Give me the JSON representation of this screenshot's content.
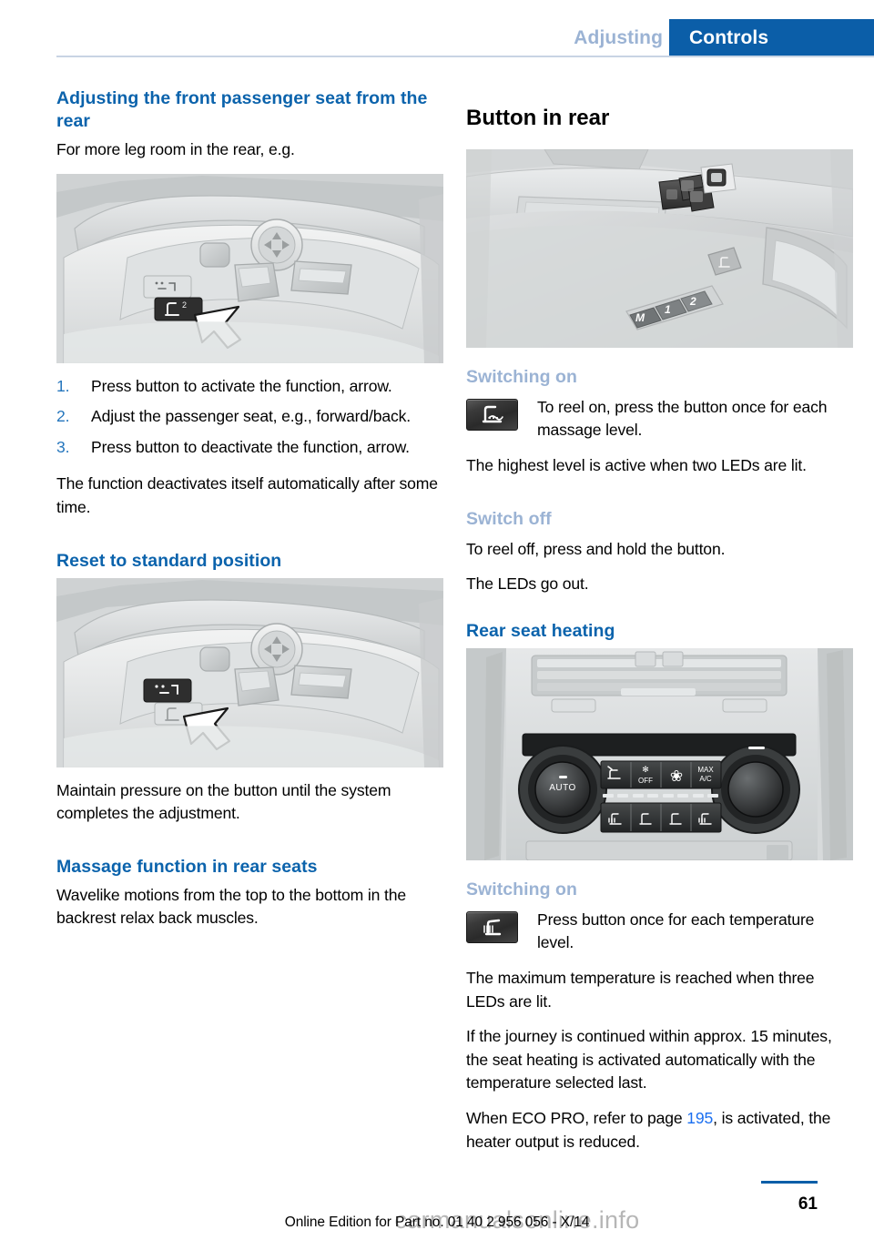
{
  "header": {
    "chapter": "Adjusting",
    "section": "Controls"
  },
  "left_column": {
    "heading_1": "Adjusting the front passenger seat from the rear",
    "intro": "For more leg room in the rear, e.g.",
    "figure_1": {
      "name": "seat-control-panel-activate",
      "caption": "Front seat side control panel with white arrow pointing to the rear-operation memory button"
    },
    "steps": [
      {
        "num": "1.",
        "text": "Press button to activate the function, arrow."
      },
      {
        "num": "2.",
        "text": "Adjust the passenger seat, e.g., forward/back."
      },
      {
        "num": "3.",
        "text": "Press button to deactivate the function, arrow."
      }
    ],
    "after_steps": "The function deactivates itself automatically after some time.",
    "heading_2": "Reset to standard position",
    "figure_2": {
      "name": "seat-control-panel-reset",
      "caption": "Front seat side control panel with white arrow pointing to the standard position button"
    },
    "reset_text": "Maintain pressure on the button until the system completes the adjustment.",
    "heading_3": "Massage function in rear seats",
    "massage_text": "Wavelike motions from the top to the bottom in the backrest relax back muscles."
  },
  "right_column": {
    "heading_button_in_rear": "Button in rear",
    "figure_door": {
      "name": "rear-door-panel",
      "caption": "Rear door panel with window switches and memory buttons M, 1, 2",
      "memory_buttons": [
        "M",
        "1",
        "2"
      ]
    },
    "heading_switching_on_1": "Switching on",
    "massage_button_icon": "seat-massage-button-icon",
    "switching_on_1_text": "To reel on, press the button once for each massage level.",
    "highest_level_text": "The highest level is active when two LEDs are lit.",
    "heading_switch_off": "Switch off",
    "switch_off_text_1": "To reel off, press and hold the button.",
    "switch_off_text_2": "The LEDs go out.",
    "heading_rear_seat_heating": "Rear seat heating",
    "figure_climate": {
      "name": "rear-climate-control-panel",
      "caption": "Rear climate control panel with AUTO knob, OFF, fan, MAX A/C and seat heating buttons",
      "labels": [
        "AUTO",
        "OFF",
        "MAX A/C"
      ]
    },
    "heading_switching_on_2": "Switching on",
    "heating_button_icon": "seat-heating-button-icon",
    "switching_on_2_text": "Press button once for each temperature level.",
    "max_temp_text": "The maximum temperature is reached when three LEDs are lit.",
    "journey_text_before": "If the journey is continued within approx. 15 minutes, the seat heating is activated automatically with the temperature selected last.",
    "eco_pro_before": "When ECO PRO, refer to page ",
    "eco_pro_page": "195",
    "eco_pro_after": ", is activated, the heater output is reduced."
  },
  "footer": {
    "page_number": "61",
    "edition": "Online Edition for Part no. 01 40 2 956 056 - X/14",
    "watermark": "carmanualsonline.info"
  },
  "colors": {
    "brand_blue": "#0b5ea8",
    "heading_blue": "#0b63ac",
    "faded_blue": "#9bb3d4",
    "link_blue": "#1b6ff0",
    "step_number_blue": "#2576bd"
  }
}
